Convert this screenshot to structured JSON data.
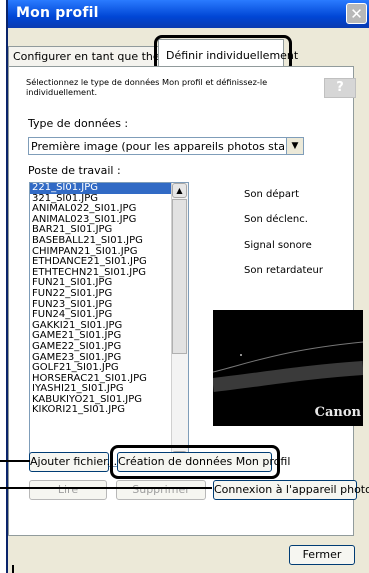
{
  "window": {
    "title": "Mon profil",
    "close_glyph": "✕"
  },
  "tabs": [
    {
      "label": "Configurer en tant que thème"
    },
    {
      "label": "Définir individuellement"
    }
  ],
  "description": "Sélectionnez le type de données Mon profil et définissez-le individuellement.",
  "help_label": "?",
  "data_type": {
    "label": "Type de données :",
    "selected": "Première image (pour les appareils photos standard)"
  },
  "workstation": {
    "label": "Poste de travail :",
    "files": [
      "221_SI01.JPG",
      "321_SI01.JPG",
      "ANIMAL022_SI01.JPG",
      "ANIMAL023_SI01.JPG",
      "BAR21_SI01.JPG",
      "BASEBALL21_SI01.JPG",
      "CHIMPAN21_SI01.JPG",
      "ETHDANCE21_SI01.JPG",
      "ETHTECHN21_SI01.JPG",
      "FUN21_SI01.JPG",
      "FUN22_SI01.JPG",
      "FUN23_SI01.JPG",
      "FUN24_SI01.JPG",
      "GAKKI21_SI01.JPG",
      "GAME21_SI01.JPG",
      "GAME22_SI01.JPG",
      "GAME23_SI01.JPG",
      "GOLF21_SI01.JPG",
      "HORSERAC21_SI01.JPG",
      "IYASHI21_SI01.JPG",
      "KABUKIYO21_SI01.JPG",
      "KIKORI21_SI01.JPG"
    ],
    "selected_index": 0
  },
  "sounds": [
    "Son départ",
    "Son déclenc.",
    "Signal sonore",
    "Son retardateur"
  ],
  "preview_brand": "Canon",
  "buttons": {
    "add_file": "Ajouter fichier...",
    "create_data": "Création de données Mon profil",
    "read": "Lire",
    "delete": "Supprimer",
    "connect": "Connexion à l'appareil photo",
    "close": "Fermer"
  },
  "icons": {
    "close": "close-icon",
    "dropdown": "chevron-down-icon",
    "scroll_up": "chevron-up-icon",
    "scroll_down": "chevron-down-icon"
  }
}
